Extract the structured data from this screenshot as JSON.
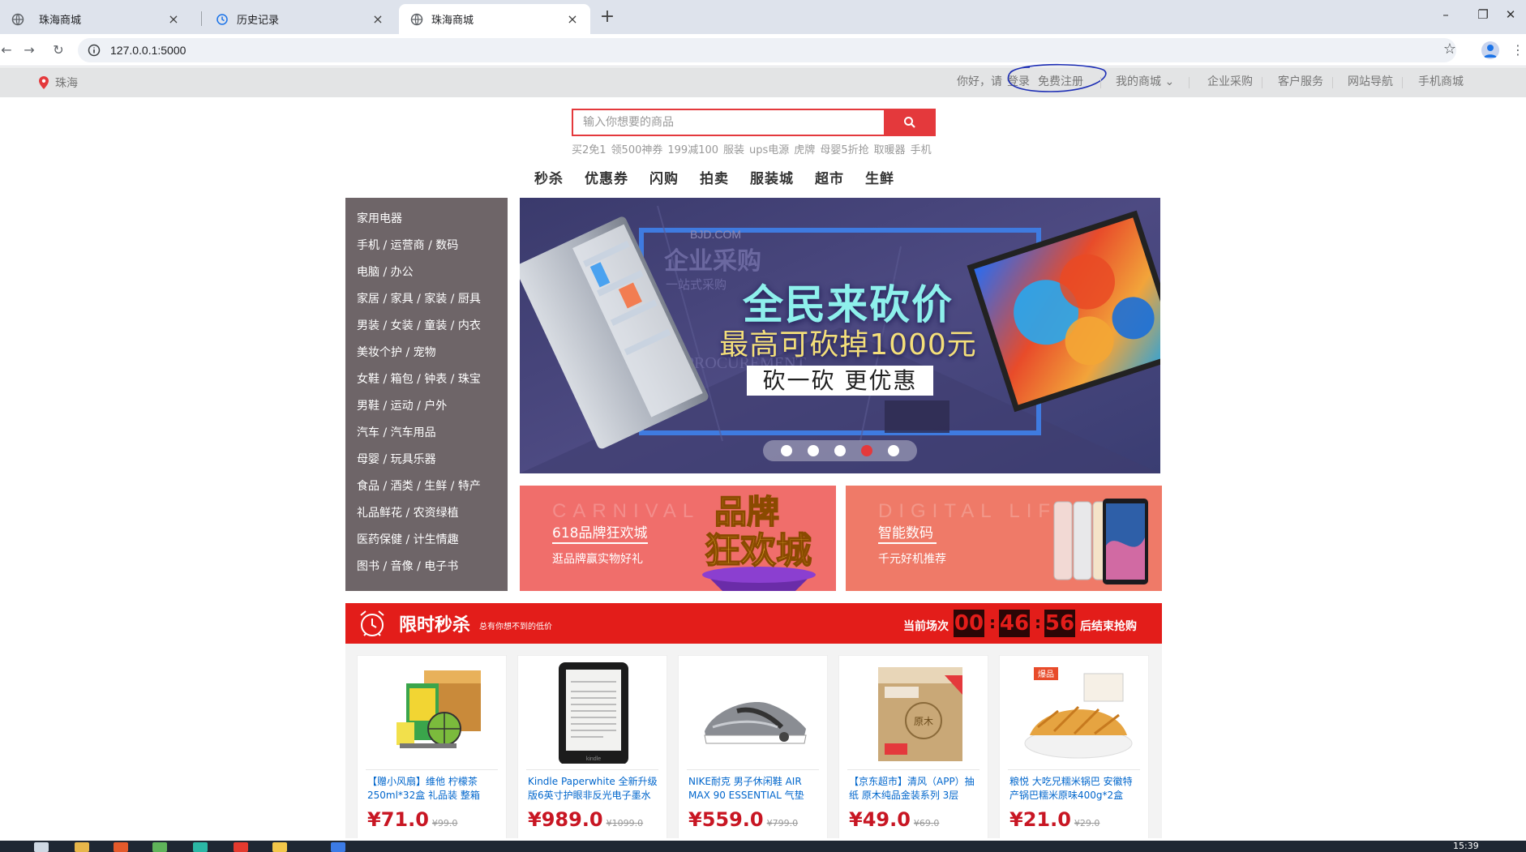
{
  "browser": {
    "tabs": [
      {
        "title": "珠海商城",
        "active": false
      },
      {
        "title": "历史记录",
        "active": false
      },
      {
        "title": "珠海商城",
        "active": true
      }
    ],
    "url": "127.0.0.1:5000"
  },
  "topbar": {
    "location": "珠海",
    "greeting": "你好，请",
    "login": "登录",
    "register": "免费注册",
    "my_mall": "我的商城",
    "links": [
      "企业采购",
      "客户服务",
      "网站导航",
      "手机商城"
    ]
  },
  "search": {
    "placeholder": "输入你想要的商品",
    "hot_words": [
      "买2免1",
      "领500神券",
      "199减100",
      "服装",
      "ups电源",
      "虎牌",
      "母婴5折抢",
      "取暖器",
      "手机"
    ]
  },
  "main_nav": [
    "秒杀",
    "优惠券",
    "闪购",
    "拍卖",
    "服装城",
    "超市",
    "生鲜"
  ],
  "categories": [
    "家用电器",
    "手机 / 运营商 / 数码",
    "电脑 / 办公",
    "家居 / 家具 / 家装 / 厨具",
    "男装 / 女装 / 童装 / 内衣",
    "美妆个护 / 宠物",
    "女鞋 / 箱包 / 钟表 / 珠宝",
    "男鞋 / 运动 / 户外",
    "汽车 / 汽车用品",
    "母婴 / 玩具乐器",
    "食品 / 酒类 / 生鲜 / 特产",
    "礼品鲜花 / 农资绿植",
    "医药保健 / 计生情趣",
    "图书 / 音像 / 电子书"
  ],
  "banner": {
    "watermark": "BJD.COM",
    "enterprise": "企业采购",
    "enterprise_sub": "一站式采购",
    "enterprise_en": "ENTERPRISE PROCUREMENT",
    "headline": "全民来砍价",
    "subheadline": "最高可砍掉1000元",
    "cta": "砍一砍 更优惠",
    "dot_count": 5,
    "active_dot": 3
  },
  "promos": [
    {
      "bg_text": "CARNIVAL",
      "title": "618品牌狂欢城",
      "subtitle": "逛品牌赢实物好礼",
      "art_text_1": "品牌",
      "art_text_2": "狂欢城"
    },
    {
      "bg_text": "DIGITAL LIFE",
      "title": "智能数码",
      "subtitle": "千元好机推荐"
    }
  ],
  "seckill": {
    "title": "限时秒杀",
    "slogan": "总有你想不到的低价",
    "countdown_label": "当前场次",
    "hours": "00",
    "minutes": "46",
    "seconds": "56",
    "countdown_suffix": "后结束抢购"
  },
  "products": [
    {
      "name": "【赠小风扇】维他 柠檬茶250ml*32盒 礼品装 整箱",
      "price": "¥71.0",
      "old_price": "¥99.0"
    },
    {
      "name": "Kindle Paperwhite 全新升级版6英寸护眼非反光电子墨水",
      "price": "¥989.0",
      "old_price": "¥1099.0"
    },
    {
      "name": "NIKE耐克 男子休闲鞋 AIR MAX 90 ESSENTIAL 气垫",
      "price": "¥559.0",
      "old_price": "¥799.0"
    },
    {
      "name": "【京东超市】清风（APP）抽纸 原木纯品金装系列 3层",
      "price": "¥49.0",
      "old_price": "¥69.0"
    },
    {
      "name": "粮悦 大吃兄糯米锅巴 安徽特产锅巴糯米原味400g*2盒",
      "price": "¥21.0",
      "old_price": "¥29.0"
    }
  ],
  "product_badge": "爆品",
  "system": {
    "time": "15:39"
  },
  "colors": {
    "brand_red": "#e4393c",
    "seckill_red": "#e31d1a",
    "category_bg": "#6e6568",
    "banner_bg": "#4a4a7a"
  }
}
